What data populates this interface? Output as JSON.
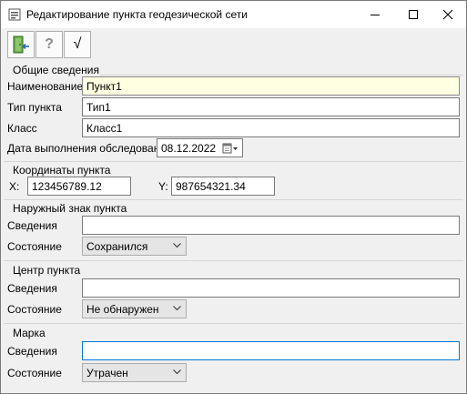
{
  "window": {
    "title": "Редактирование пункта геодезической сети"
  },
  "toolbar": {
    "exit_icon": "exit-door-icon",
    "help_label": "?",
    "ok_label": "√"
  },
  "general": {
    "title": "Общие сведения",
    "name_label": "Наименование",
    "name_value": "Пункт1",
    "type_label": "Тип пункта",
    "type_value": "Тип1",
    "class_label": "Класс",
    "class_value": "Класс1",
    "date_label": "Дата выполнения обследования",
    "date_value": "08.12.2022"
  },
  "coords": {
    "title": "Координаты пункта",
    "x_label": "X:",
    "x_value": "123456789.12",
    "y_label": "Y:",
    "y_value": "987654321.34"
  },
  "outer_sign": {
    "title": "Наружный знак пункта",
    "info_label": "Сведения",
    "info_value": "",
    "state_label": "Состояние",
    "state_value": "Сохранился"
  },
  "center": {
    "title": "Центр пункта",
    "info_label": "Сведения",
    "info_value": "",
    "state_label": "Состояние",
    "state_value": "Не обнаружен"
  },
  "mark": {
    "title": "Марка",
    "info_label": "Сведения",
    "info_value": "",
    "state_label": "Состояние",
    "state_value": "Утрачен"
  },
  "colors": {
    "highlight_field": "#ffffe1",
    "focus_border": "#0078d7",
    "close_hover": "#e81123"
  }
}
